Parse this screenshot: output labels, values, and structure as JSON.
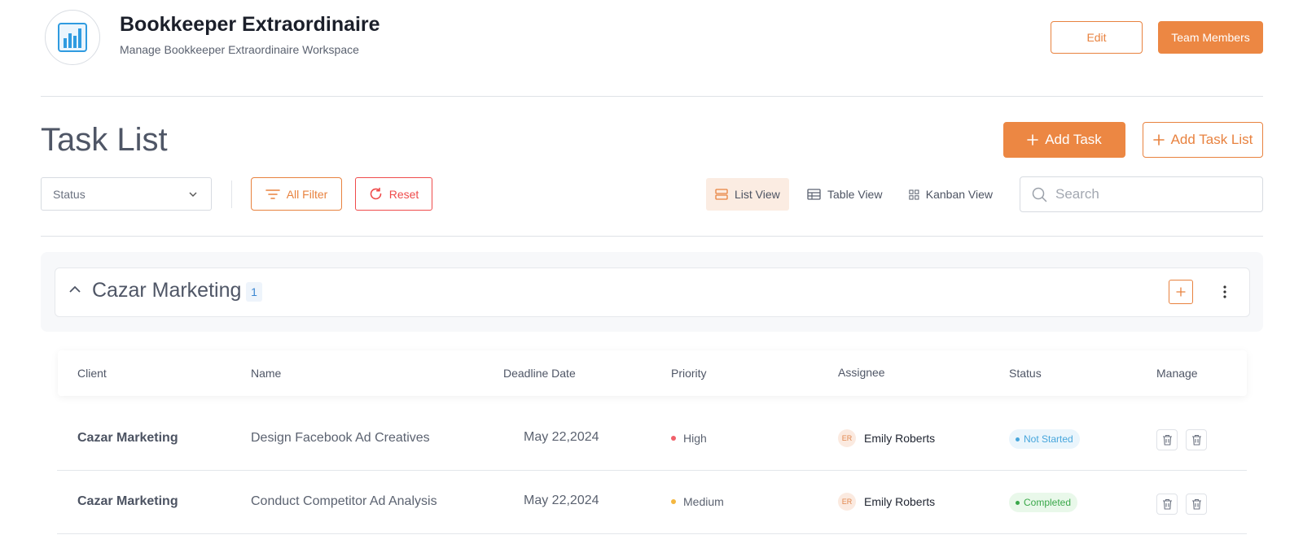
{
  "workspace": {
    "title": "Bookkeeper Extraordinaire",
    "subtitle": "Manage Bookkeeper Extraordinaire Workspace",
    "logo_icon": "bar-chart-icon"
  },
  "header_actions": {
    "edit_label": "Edit",
    "team_label": "Team Members"
  },
  "page": {
    "title": "Task List",
    "add_task_label": "Add Task",
    "add_task_list_label": "Add Task List"
  },
  "filters": {
    "status_placeholder": "Status",
    "all_filter_label": "All Filter",
    "reset_label": "Reset"
  },
  "views": {
    "list_label": "List View",
    "table_label": "Table View",
    "kanban_label": "Kanban View",
    "active": "list"
  },
  "search": {
    "placeholder": "Search"
  },
  "group": {
    "name": "Cazar Marketing",
    "count": "1"
  },
  "table": {
    "headers": {
      "client": "Client",
      "name": "Name",
      "deadline": "Deadline Date",
      "priority": "Priority",
      "assignee": "Assignee",
      "status": "Status",
      "manage": "Manage"
    },
    "rows": [
      {
        "client": "Cazar Marketing",
        "name": "Design Facebook Ad Creatives",
        "deadline": "May 22,2024",
        "priority": "High",
        "priority_color": "#f0606a",
        "assignee_initials": "ER",
        "assignee": "Emily Roberts",
        "status": "Not Started"
      },
      {
        "client": "Cazar Marketing",
        "name": "Conduct Competitor Ad Analysis",
        "deadline": "May 22,2024",
        "priority": "Medium",
        "priority_color": "#f4b740",
        "assignee_initials": "ER",
        "assignee": "Emily Roberts",
        "status": "Completed"
      }
    ]
  },
  "colors": {
    "accent": "#ec8743",
    "danger": "#ef4b4b",
    "status_not_started": "#47a6dc",
    "status_completed": "#3aa84a"
  }
}
